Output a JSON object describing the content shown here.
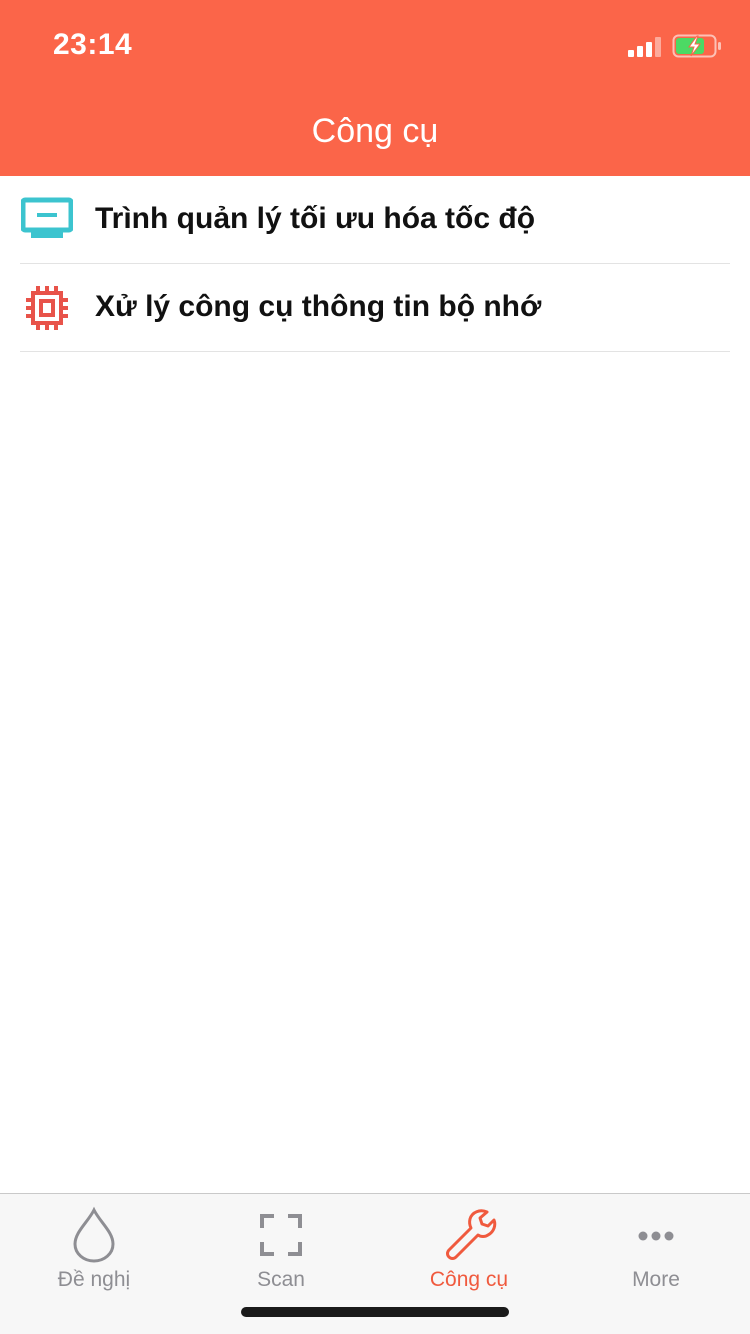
{
  "status_bar": {
    "time": "23:14",
    "signal_icon": "cellular-signal-icon",
    "battery_icon": "battery-charging-icon"
  },
  "header": {
    "title": "Công cụ",
    "background_color": "#fb6549"
  },
  "list": {
    "items": [
      {
        "label": "Trình quản lý tối ưu hóa tốc độ",
        "icon": "monitor-icon",
        "icon_color": "#3cc4cf"
      },
      {
        "label": "Xử lý công cụ thông tin bộ nhớ",
        "icon": "cpu-chip-icon",
        "icon_color": "#e8534a"
      }
    ]
  },
  "tabbar": {
    "active_index": 2,
    "active_color": "#f05a3e",
    "inactive_color": "#8e8e93",
    "tabs": [
      {
        "label": "Đề nghị",
        "icon": "water-drop-icon"
      },
      {
        "label": "Scan",
        "icon": "scan-frame-icon"
      },
      {
        "label": "Công cụ",
        "icon": "wrench-icon"
      },
      {
        "label": "More",
        "icon": "more-dots-icon"
      }
    ]
  }
}
